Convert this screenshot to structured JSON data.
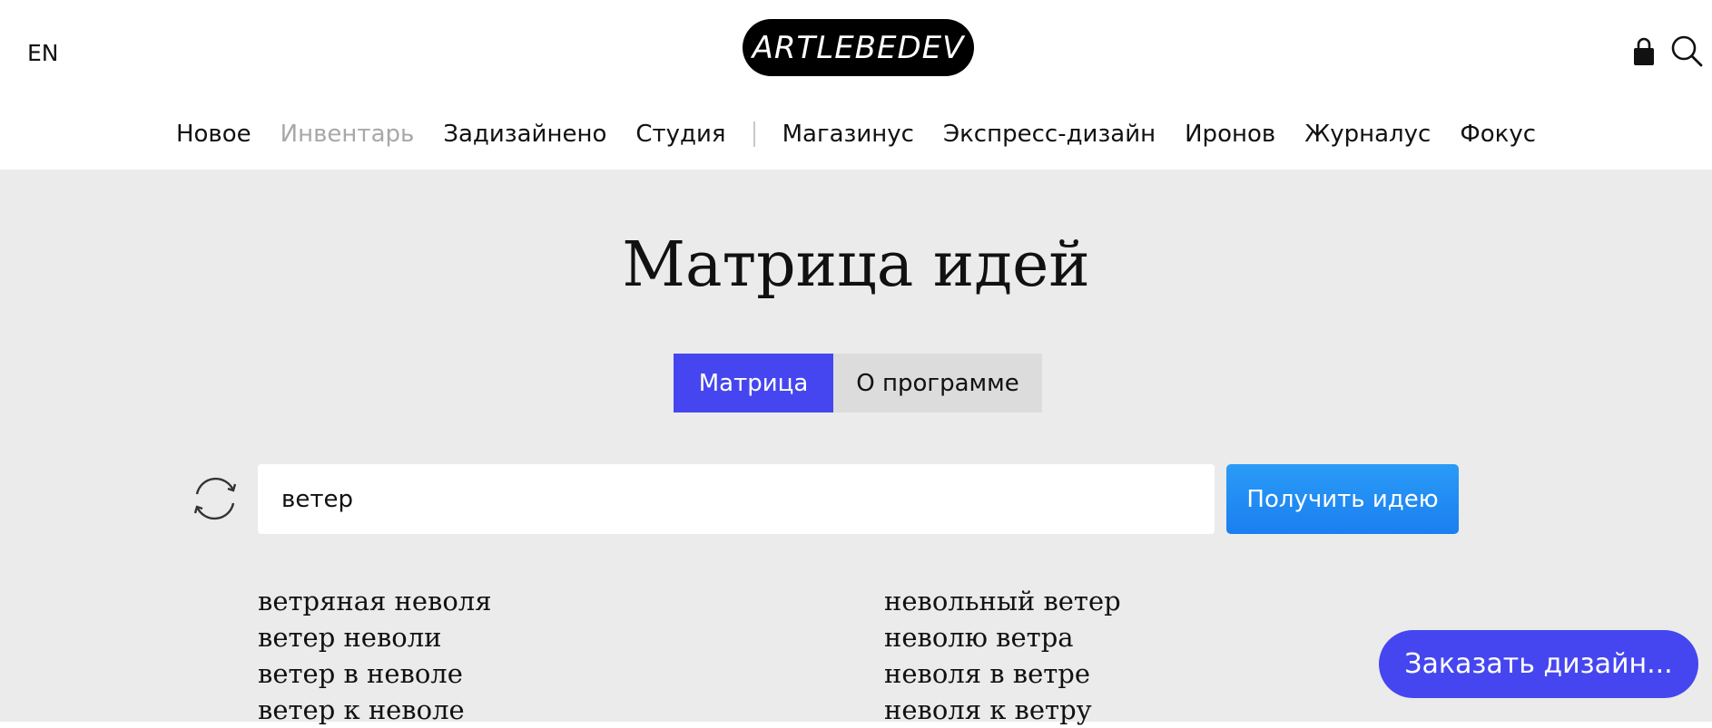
{
  "header": {
    "lang": "EN",
    "logo_text": "ARTLEBEDEV",
    "icons": {
      "cart": "shopping-bag-icon",
      "search": "search-icon"
    }
  },
  "nav": {
    "items": [
      "Новое",
      "Инвентарь",
      "Задизайнено",
      "Студия",
      "Магазинус",
      "Экспресс-дизайн",
      "Иронов",
      "Журналус",
      "Фокус"
    ]
  },
  "page": {
    "title": "Матрица идей",
    "tabs": [
      {
        "label": "Матрица",
        "active": true
      },
      {
        "label": "О программе",
        "active": false
      }
    ]
  },
  "search": {
    "value": "ветер",
    "button_label": "Получить идею",
    "refresh_icon": "refresh-icon"
  },
  "results": {
    "left": [
      "ветряная неволя",
      "ветер неволи",
      "ветер в неволе",
      "ветер к неволе"
    ],
    "right": [
      "невольный ветер",
      "неволю ветра",
      "неволя в ветре",
      "неволя к ветру"
    ]
  },
  "cta": {
    "label": "Заказать дизайн..."
  },
  "colors": {
    "accent": "#4646f0",
    "button_blue": "#1a8cf5",
    "background_gray": "#ebebeb"
  }
}
